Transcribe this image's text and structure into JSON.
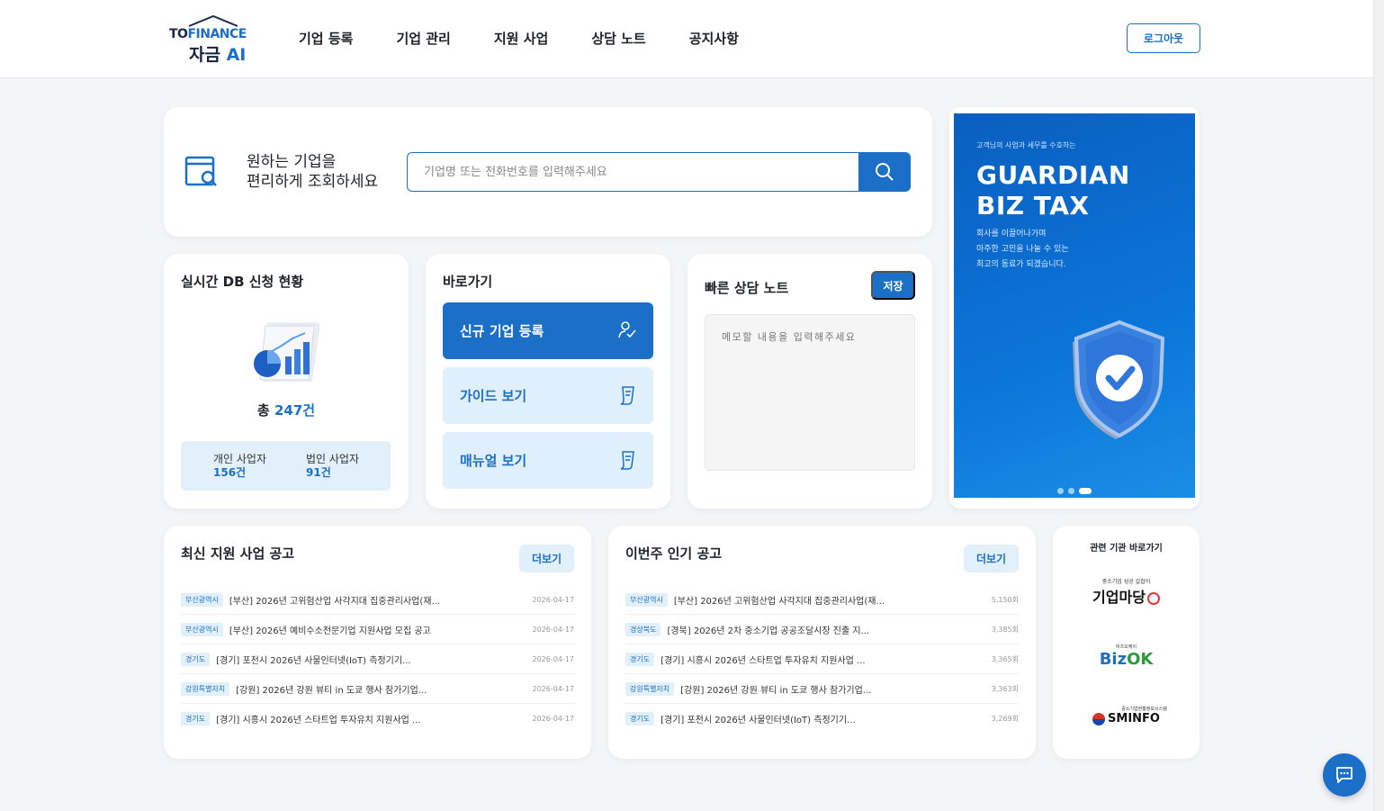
{
  "header": {
    "logo": {
      "line1_a": "TO",
      "line1_b": "FINANCE",
      "line2_a": "자금",
      "line2_b": "AI"
    },
    "nav": [
      "기업 등록",
      "기업 관리",
      "지원 사업",
      "상담 노트",
      "공지사항"
    ],
    "logout_label": "로그아웃"
  },
  "search": {
    "title_line1": "원하는 기업을",
    "title_line2": "편리하게 조회하세요",
    "placeholder": "기업명 또는 전화번호를 입력해주세요"
  },
  "banner": {
    "small": "고객님의 사업과 세무를 수호하는",
    "title_line1": "GUARDIAN",
    "title_line2": "BIZ TAX",
    "desc_line1": "회사를 이끌어나가며",
    "desc_line2": "마주한 고민을 나눌 수 있는",
    "desc_line3": "최고의 동료가 되겠습니다.",
    "active_slide": 3,
    "slide_count": 3
  },
  "db_status": {
    "title": "실시간 DB 신청 현황",
    "total_prefix": "총",
    "total_value": "247건",
    "personal_label": "개인 사업자",
    "personal_value": "156건",
    "corporate_label": "법인 사업자",
    "corporate_value": "91건"
  },
  "shortcuts": {
    "title": "바로가기",
    "items": [
      "신규 기업 등록",
      "가이드 보기",
      "매뉴얼 보기"
    ]
  },
  "memo": {
    "title": "빠른 상담 노트",
    "save_label": "저장",
    "placeholder": "메모할 내용을 입력해주세요"
  },
  "latest_notices": {
    "title": "최신 지원 사업 공고",
    "more_label": "더보기",
    "rows": [
      {
        "tag": "부산광역시",
        "title": "[부산] 2026년 고위험산업 사각지대 집중관리사업(재...",
        "meta": "2026-04-17"
      },
      {
        "tag": "부산광역시",
        "title": "[부산] 2026년 예비수소전문기업 지원사업 모집 공고",
        "meta": "2026-04-17"
      },
      {
        "tag": "경기도",
        "title": "[경기] 포천시 2026년 사물인터넷(IoT) 측정기기...",
        "meta": "2026-04-17"
      },
      {
        "tag": "강원특별자치",
        "title": "[강원] 2026년 강원 뷰티 in 도쿄 행사 참가기업...",
        "meta": "2026-04-17"
      },
      {
        "tag": "경기도",
        "title": "[경기] 시흥시 2026년 스타트업 투자유치 지원사업 ...",
        "meta": "2026-04-17"
      }
    ]
  },
  "popular_notices": {
    "title": "이번주 인기 공고",
    "more_label": "더보기",
    "rows": [
      {
        "tag": "부산광역시",
        "title": "[부산] 2026년 고위험산업 사각지대 집중관리사업(재...",
        "meta": "5,150회"
      },
      {
        "tag": "경상북도",
        "title": "[경북] 2026년 2차 중소기업 공공조달시장 진출 지...",
        "meta": "3,385회"
      },
      {
        "tag": "경기도",
        "title": "[경기] 시흥시 2026년 스타트업 투자유치 지원사업 ...",
        "meta": "3,365회"
      },
      {
        "tag": "강원특별자치",
        "title": "[강원] 2026년 강원 뷰티 in 도쿄 행사 참가기업...",
        "meta": "3,363회"
      },
      {
        "tag": "경기도",
        "title": "[경기] 포천시 2026년 사물인터넷(IoT) 측정기기...",
        "meta": "3,269회"
      }
    ]
  },
  "related": {
    "title": "관련 기관 바로가기",
    "bizmadang_small": "중소기업 성공 길잡이",
    "bizmadang": "기업마당",
    "bizok_small": "비즈오케이",
    "bizok_a": "Biz",
    "bizok_b": "OK",
    "sminfo_small": "중소기업현황정보시스템",
    "sminfo": "SMINFO"
  },
  "colors": {
    "primary": "#1c6fc7",
    "light": "#e2f0fb",
    "background": "#f4f5f7"
  },
  "icons": [
    "search-icon",
    "company-search-icon",
    "chart-illustration",
    "register-icon",
    "document-icon",
    "shield-check-icon",
    "chat-icon"
  ]
}
